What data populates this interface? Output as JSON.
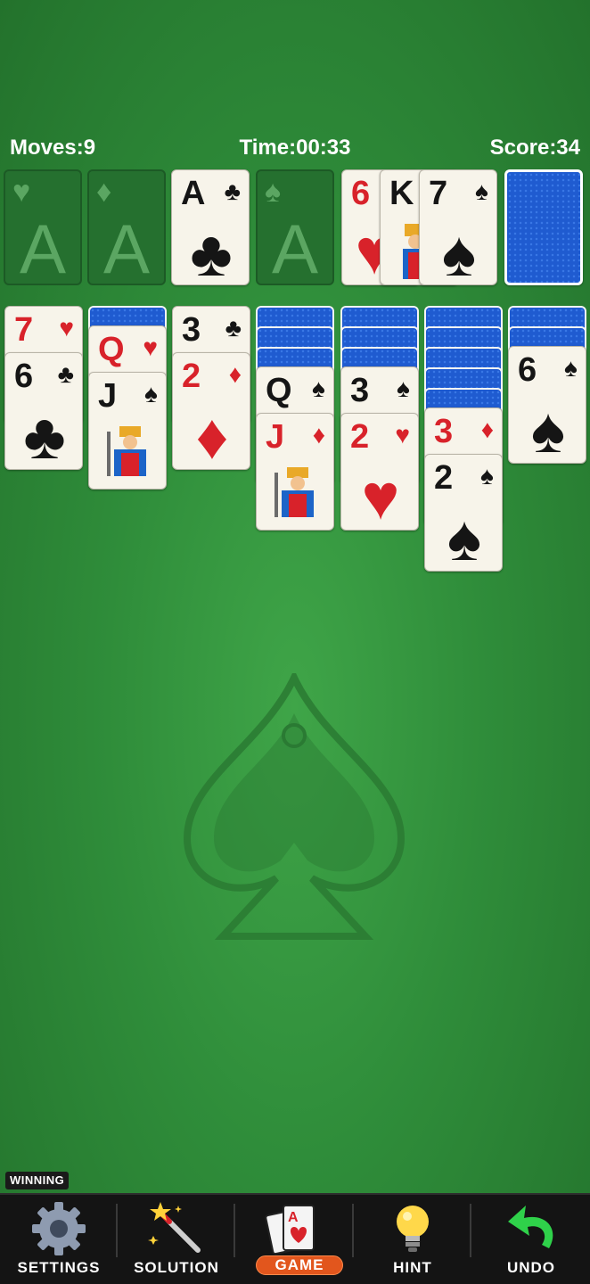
{
  "hud": {
    "moves": "Moves:9",
    "time": "Time:00:33",
    "score": "Score:34"
  },
  "foundations": [
    {
      "suit": "♥",
      "label": "A",
      "empty": true
    },
    {
      "suit": "♦",
      "label": "A",
      "empty": true
    },
    {
      "rank": "A",
      "suit": "♣",
      "color": "black",
      "empty": false
    },
    {
      "suit": "♠",
      "label": "A",
      "empty": true
    }
  ],
  "waste": [
    {
      "rank": "6",
      "suit": "♥",
      "color": "red"
    },
    {
      "rank": "K",
      "suit": "♠",
      "color": "black"
    },
    {
      "rank": "7",
      "suit": "♠",
      "color": "black"
    }
  ],
  "tableau": [
    {
      "hidden": 0,
      "cards": [
        {
          "rank": "7",
          "suit": "♥",
          "color": "red"
        },
        {
          "rank": "6",
          "suit": "♣",
          "color": "black"
        }
      ]
    },
    {
      "hidden": 1,
      "cards": [
        {
          "rank": "Q",
          "suit": "♥",
          "color": "red"
        },
        {
          "rank": "J",
          "suit": "♠",
          "color": "black"
        }
      ]
    },
    {
      "hidden": 0,
      "cards": [
        {
          "rank": "3",
          "suit": "♣",
          "color": "black"
        },
        {
          "rank": "2",
          "suit": "♦",
          "color": "red"
        }
      ]
    },
    {
      "hidden": 3,
      "cards": [
        {
          "rank": "Q",
          "suit": "♠",
          "color": "black"
        },
        {
          "rank": "J",
          "suit": "♦",
          "color": "red"
        }
      ]
    },
    {
      "hidden": 3,
      "cards": [
        {
          "rank": "3",
          "suit": "♠",
          "color": "black"
        },
        {
          "rank": "2",
          "suit": "♥",
          "color": "red"
        }
      ]
    },
    {
      "hidden": 5,
      "cards": [
        {
          "rank": "3",
          "suit": "♦",
          "color": "red"
        },
        {
          "rank": "2",
          "suit": "♠",
          "color": "black"
        }
      ]
    },
    {
      "hidden": 2,
      "cards": [
        {
          "rank": "6",
          "suit": "♠",
          "color": "black"
        }
      ]
    }
  ],
  "badge": "WINNING",
  "toolbar": {
    "settings": "SETTINGS",
    "solution": "SOLUTION",
    "game": "GAME",
    "hint": "HINT",
    "undo": "UNDO"
  },
  "colors": {
    "table": "#2f8d3a",
    "red_suit": "#d8222a",
    "card_back": "#1f5bd0",
    "game_pill": "#e2561d",
    "undo_arrow": "#2fd14a"
  }
}
